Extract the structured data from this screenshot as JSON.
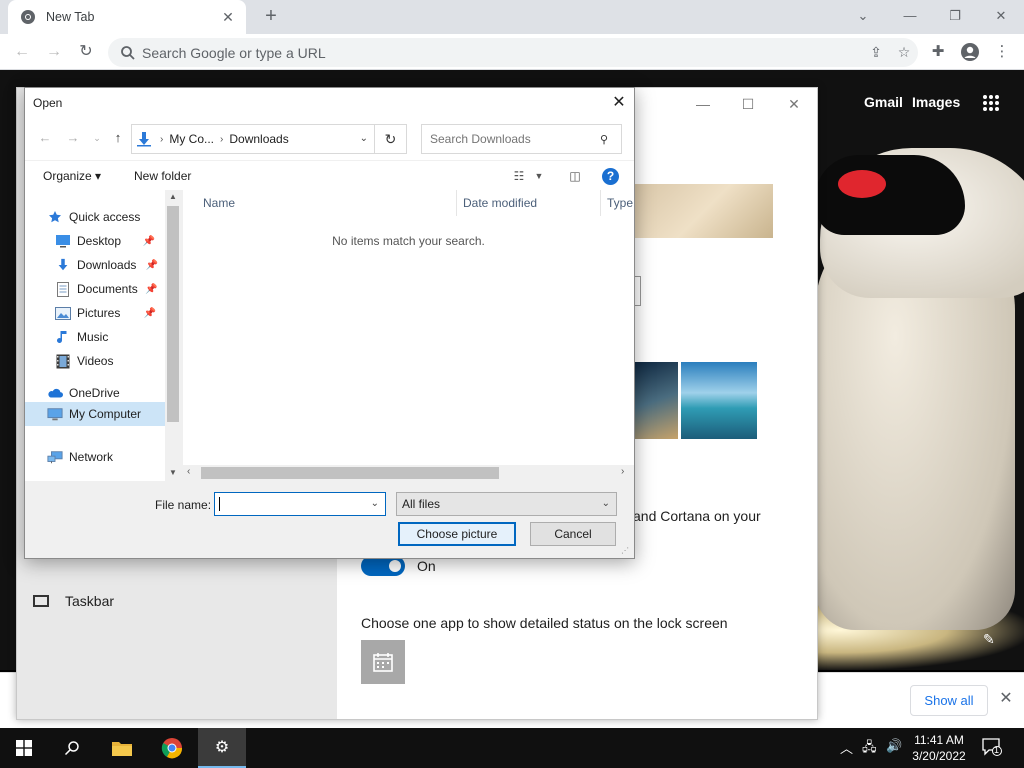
{
  "browser": {
    "tab_title": "New Tab",
    "omnibox_placeholder": "Search Google or type a URL"
  },
  "newtab": {
    "links": {
      "gmail": "Gmail",
      "images": "Images"
    },
    "show_all": "Show all"
  },
  "settings_bg": {
    "sidebar_item": "Taskbar",
    "cortana_text": "and Cortana on your",
    "toggle_label": "On",
    "lock_status_text": "Choose one app to show detailed status on the lock screen"
  },
  "dialog": {
    "title": "Open",
    "breadcrumb": [
      "My Co...",
      "Downloads"
    ],
    "search_placeholder": "Search Downloads",
    "organize": "Organize",
    "new_folder": "New folder",
    "nav_items": [
      {
        "label": "Quick access",
        "icon": "star-icon"
      },
      {
        "label": "Desktop",
        "icon": "desktop-icon"
      },
      {
        "label": "Downloads",
        "icon": "download-arrow-icon"
      },
      {
        "label": "Documents",
        "icon": "document-icon"
      },
      {
        "label": "Pictures",
        "icon": "pictures-icon"
      },
      {
        "label": "Music",
        "icon": "music-note-icon"
      },
      {
        "label": "Videos",
        "icon": "film-icon"
      },
      {
        "label": "OneDrive",
        "icon": "cloud-icon"
      },
      {
        "label": "My Computer",
        "icon": "computer-icon"
      },
      {
        "label": "Network",
        "icon": "network-icon"
      }
    ],
    "columns": [
      "Name",
      "Date modified",
      "Type"
    ],
    "empty_message": "No items match your search.",
    "file_name_label": "File name:",
    "file_name_value": "",
    "file_type_selected": "All files",
    "primary_button": "Choose picture",
    "cancel_button": "Cancel"
  },
  "taskbar": {
    "time": "11:41 AM",
    "date": "3/20/2022",
    "notification_count": "1"
  },
  "colors": {
    "accent": "#0067c0",
    "help_blue": "#1a6fd1",
    "selection": "#cce4f7",
    "eye_red": "#e0262e"
  }
}
